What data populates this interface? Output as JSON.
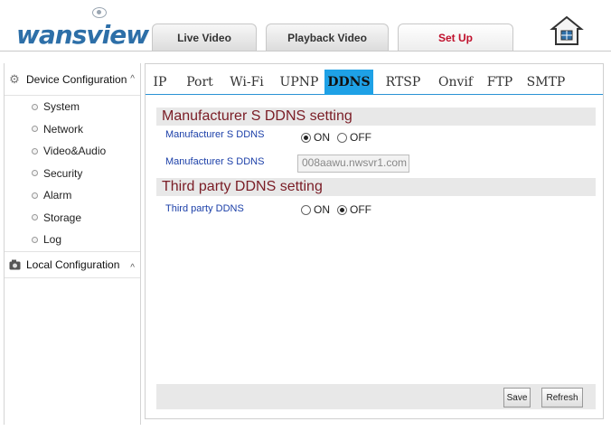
{
  "header": {
    "logo_text": "wansview",
    "tabs": {
      "live": "Live Video",
      "playback": "Playback Video",
      "setup": "Set Up"
    },
    "home_icon": "home-icon"
  },
  "sidebar": {
    "device_config": "Device Configuration",
    "items": [
      "System",
      "Network",
      "Video&Audio",
      "Security",
      "Alarm",
      "Storage",
      "Log"
    ],
    "local_config": "Local Configuration"
  },
  "subtabs": {
    "ip": "IP",
    "port": "Port",
    "wifi": "Wi-Fi",
    "upnp": "UPNP",
    "ddns": "DDNS",
    "rtsp": "RTSP",
    "onvif": "Onvif",
    "ftp": "FTP",
    "smtp": "SMTP",
    "active": "DDNS"
  },
  "manufacturer": {
    "section_title": "Manufacturer S DDNS setting",
    "enable_label": "Manufacturer S DDNS",
    "on_label": "ON",
    "off_label": "OFF",
    "enabled": "ON",
    "domain_label": "Manufacturer S DDNS",
    "domain_value": "008aawu.nwsvr1.com"
  },
  "third_party": {
    "section_title": "Third party DDNS setting",
    "enable_label": "Third party DDNS",
    "on_label": "ON",
    "off_label": "OFF",
    "enabled": "OFF"
  },
  "buttons": {
    "save": "Save",
    "refresh": "Refresh"
  },
  "colors": {
    "accent": "#1ea1e6",
    "active_tab_text": "#c0102c",
    "section_title": "#7a1c25",
    "field_label": "#1b3fa8"
  }
}
